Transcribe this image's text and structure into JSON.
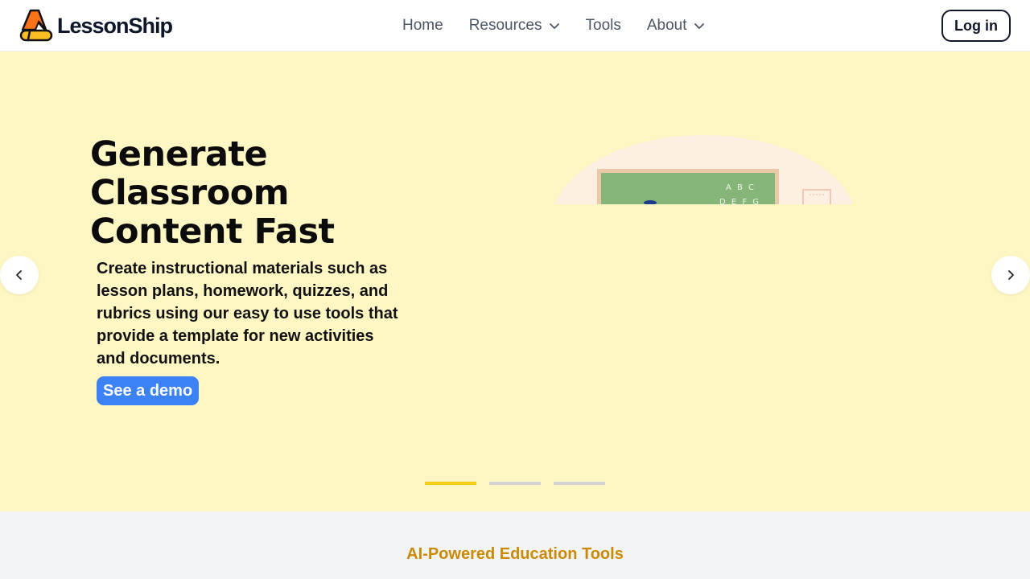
{
  "header": {
    "brand": "LessonShip",
    "nav": [
      {
        "label": "Home",
        "dropdown": false
      },
      {
        "label": "Resources",
        "dropdown": true
      },
      {
        "label": "Tools",
        "dropdown": false
      },
      {
        "label": "About",
        "dropdown": true
      }
    ],
    "login_label": "Log in"
  },
  "hero": {
    "title": "Generate Classroom Content Fast",
    "description": "Create instructional materials such as lesson plans, homework, quizzes, and rubrics using our easy to use tools that provide a template for new activities and documents.",
    "cta_label": "See a demo",
    "illustration_chalk_text": "A B C",
    "prev_icon": "chevron-left-icon",
    "next_icon": "chevron-right-icon",
    "slides_total": 3,
    "active_slide": 1
  },
  "section": {
    "label": "AI-Powered Education Tools"
  },
  "colors": {
    "hero_bg": "#fef7c3",
    "accent_blue": "#3b82f6",
    "accent_yellow": "#facc15",
    "section_label": "#ca8a04"
  }
}
